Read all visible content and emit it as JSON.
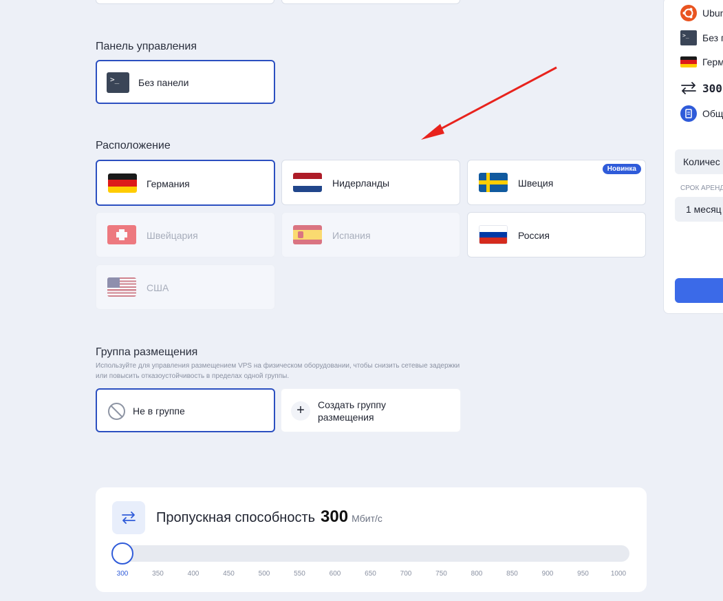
{
  "panel": {
    "title": "Панель управления",
    "option": "Без панели",
    "terminal_glyph": ">_"
  },
  "location": {
    "title": "Расположение",
    "countries": [
      {
        "name": "Германия",
        "state": "selected"
      },
      {
        "name": "Нидерланды",
        "state": "available"
      },
      {
        "name": "Швеция",
        "state": "available",
        "badge": "Новинка"
      },
      {
        "name": "Швейцария",
        "state": "disabled"
      },
      {
        "name": "Испания",
        "state": "disabled"
      },
      {
        "name": "Россия",
        "state": "available"
      },
      {
        "name": "США",
        "state": "disabled"
      }
    ]
  },
  "placement": {
    "title": "Группа размещения",
    "description_line1": "Используйте для управления размещением VPS на физическом оборудовании, чтобы снизить сетевые задержки",
    "description_line2": "или повысить отказоустойчивость в пределах одной группы.",
    "no_group": "Не в группе",
    "create_line1": "Создать группу",
    "create_line2": "размещения",
    "plus_glyph": "+"
  },
  "bandwidth": {
    "label": "Пропускная способность",
    "value": "300",
    "unit": "Мбит/с",
    "slider_value": 300,
    "slider_min": 300,
    "slider_max": 1000,
    "ticks": [
      "300",
      "350",
      "400",
      "450",
      "500",
      "550",
      "600",
      "650",
      "700",
      "750",
      "800",
      "850",
      "900",
      "950",
      "1000"
    ]
  },
  "summary": {
    "os": "Ubun",
    "panel": "Без п",
    "location": "Герм",
    "bandwidth": "300",
    "storage": "Общ",
    "quantity": "Количес",
    "term_label": "СРОК АРЕНД",
    "term_value": "1 месяц"
  },
  "colors": {
    "accent": "#2f5bd9",
    "selected_border": "#2b4fc0",
    "background": "#edf0f7",
    "arrow": "#e8231d"
  }
}
